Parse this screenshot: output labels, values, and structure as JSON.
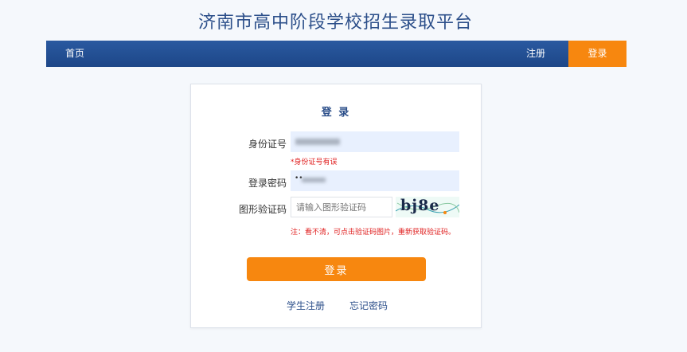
{
  "site": {
    "title": "济南市高中阶段学校招生录取平台"
  },
  "nav": {
    "home": "首页",
    "register": "注册",
    "login": "登录"
  },
  "form": {
    "title": "登 录",
    "id_label": "身份证号",
    "id_error": "*身份证号有误",
    "password_label": "登录密码",
    "password_prefix": "••",
    "captcha_label": "图形验证码",
    "captcha_placeholder": "请输入图形验证码",
    "captcha_text": "bj8e",
    "captcha_hint": "注：看不清，可点击验证码图片，重新获取验证码。",
    "submit": "登录",
    "student_register": "学生注册",
    "forgot_password": "忘记密码"
  },
  "colors": {
    "brand_blue": "#2a59a0",
    "accent_orange": "#f7870f",
    "error_red": "#e02020"
  }
}
